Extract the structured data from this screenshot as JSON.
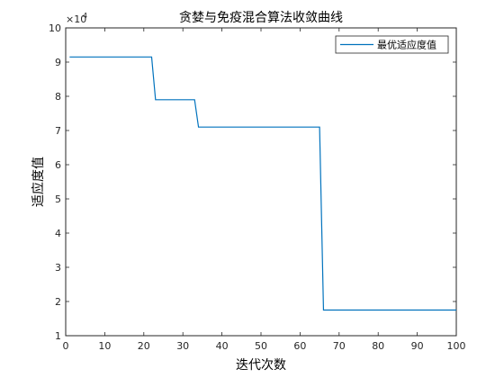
{
  "chart_data": {
    "type": "line",
    "title": "贪婪与免疫混合算法收敛曲线",
    "xlabel": "迭代次数",
    "ylabel": "适应度值",
    "exponent_base": "×10",
    "exponent_power": "4",
    "xlim": [
      0,
      100
    ],
    "ylim": [
      1,
      10
    ],
    "xticks": [
      "0",
      "10",
      "20",
      "30",
      "40",
      "50",
      "60",
      "70",
      "80",
      "90",
      "100"
    ],
    "yticks": [
      "1",
      "2",
      "3",
      "4",
      "5",
      "6",
      "7",
      "8",
      "9",
      "10"
    ],
    "legend_position": "top-right",
    "grid": false,
    "series": [
      {
        "name": "最优适应度值",
        "color": "#0072BD",
        "x": [
          1,
          22,
          23,
          33,
          34,
          65,
          66,
          100
        ],
        "y": [
          9.15,
          9.15,
          7.9,
          7.9,
          7.1,
          7.1,
          1.75,
          1.75
        ]
      }
    ]
  }
}
